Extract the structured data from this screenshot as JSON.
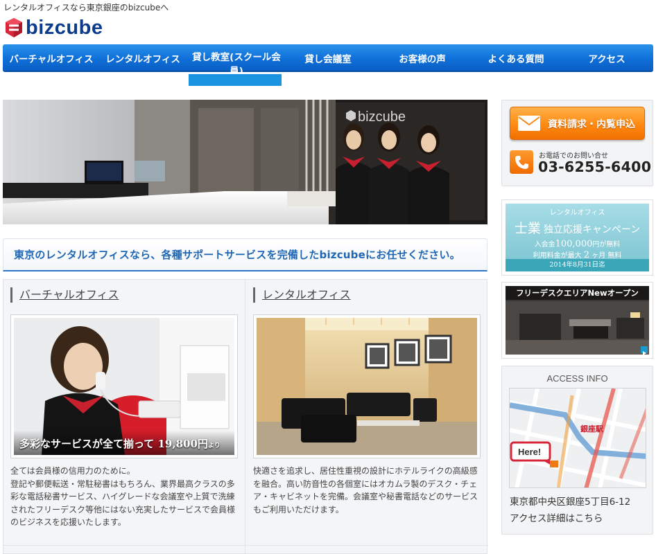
{
  "header": {
    "tagline": "レンタルオフィスなら東京銀座のbizcubeへ",
    "logo_text": "bizcube"
  },
  "nav": {
    "items": [
      {
        "label": "バーチャルオフィス"
      },
      {
        "label": "レンタルオフィス"
      },
      {
        "label": "貸し教室(スクール会員)"
      },
      {
        "label": "貸し会議室"
      },
      {
        "label": "お客様の声"
      },
      {
        "label": "よくある質問"
      },
      {
        "label": "アクセス"
      }
    ]
  },
  "hero": {
    "sign_text": "bizcube"
  },
  "lead": {
    "text": "東京のレンタルオフィスなら、各種サポートサービスを完備したbizcubeにお任せください。"
  },
  "sections": [
    {
      "title": "バーチャルオフィス",
      "caption_main": "多彩なサービスが全て揃って 19,800",
      "caption_unit": "円",
      "caption_suffix": "より",
      "text": "全ては会員様の信用力のために。\n登記や郵便転送・常駐秘書はもちろん、業界最高クラスの多彩な電話秘書サービス、ハイグレードな会議室や上質で洗練されたフリーデスク等他にはない充実したサービスで会員様のビジネスを応援いたします。"
    },
    {
      "title": "レンタルオフィス",
      "text": "快適さを追求し、居住性重視の設計にホテルライクの高級感を融合。高い防音性の各個室にはオカムラ製のデスク・チェア・キャビネットを完備。会議室や秘書電話などのサービスもご利用いただけます。"
    }
  ],
  "sidebar": {
    "request_button": "資料請求・内覧申込",
    "tel_sub": "お電話でのお問い合せ",
    "tel_number": "03-6255-6400",
    "campaign": {
      "top": "レンタルオフィス",
      "main_big": "士業",
      "main_rest": "独立応援キャンペーン",
      "sub_1": "入会金",
      "sub_1_val": "100,000",
      "sub_1_unit": "円が無料",
      "sub_2": "利用料金が最大",
      "sub_2_val": "2",
      "sub_2_unit": "ヶ月",
      "sub_2_end": "無料",
      "date": "2014年8月31日迄"
    },
    "freedesk_banner": "フリーデスクエリアNewオープン",
    "access": {
      "heading": "ACCESS INFO",
      "map_station": "銀座駅",
      "map_here": "Here!",
      "address": "東京都中央区銀座5丁目6-12",
      "link": "アクセス詳細はこちら"
    }
  },
  "colors": {
    "nav_blue": "#1275df",
    "brand_navy": "#0c3b8c",
    "brand_red": "#d6263a",
    "lead_blue": "#1f66b3",
    "cta_orange": "#ff8a12",
    "campaign_teal": "#8fd0dc"
  },
  "icons": {
    "mail": "mail-icon",
    "phone": "phone-icon",
    "play": "play-icon"
  }
}
